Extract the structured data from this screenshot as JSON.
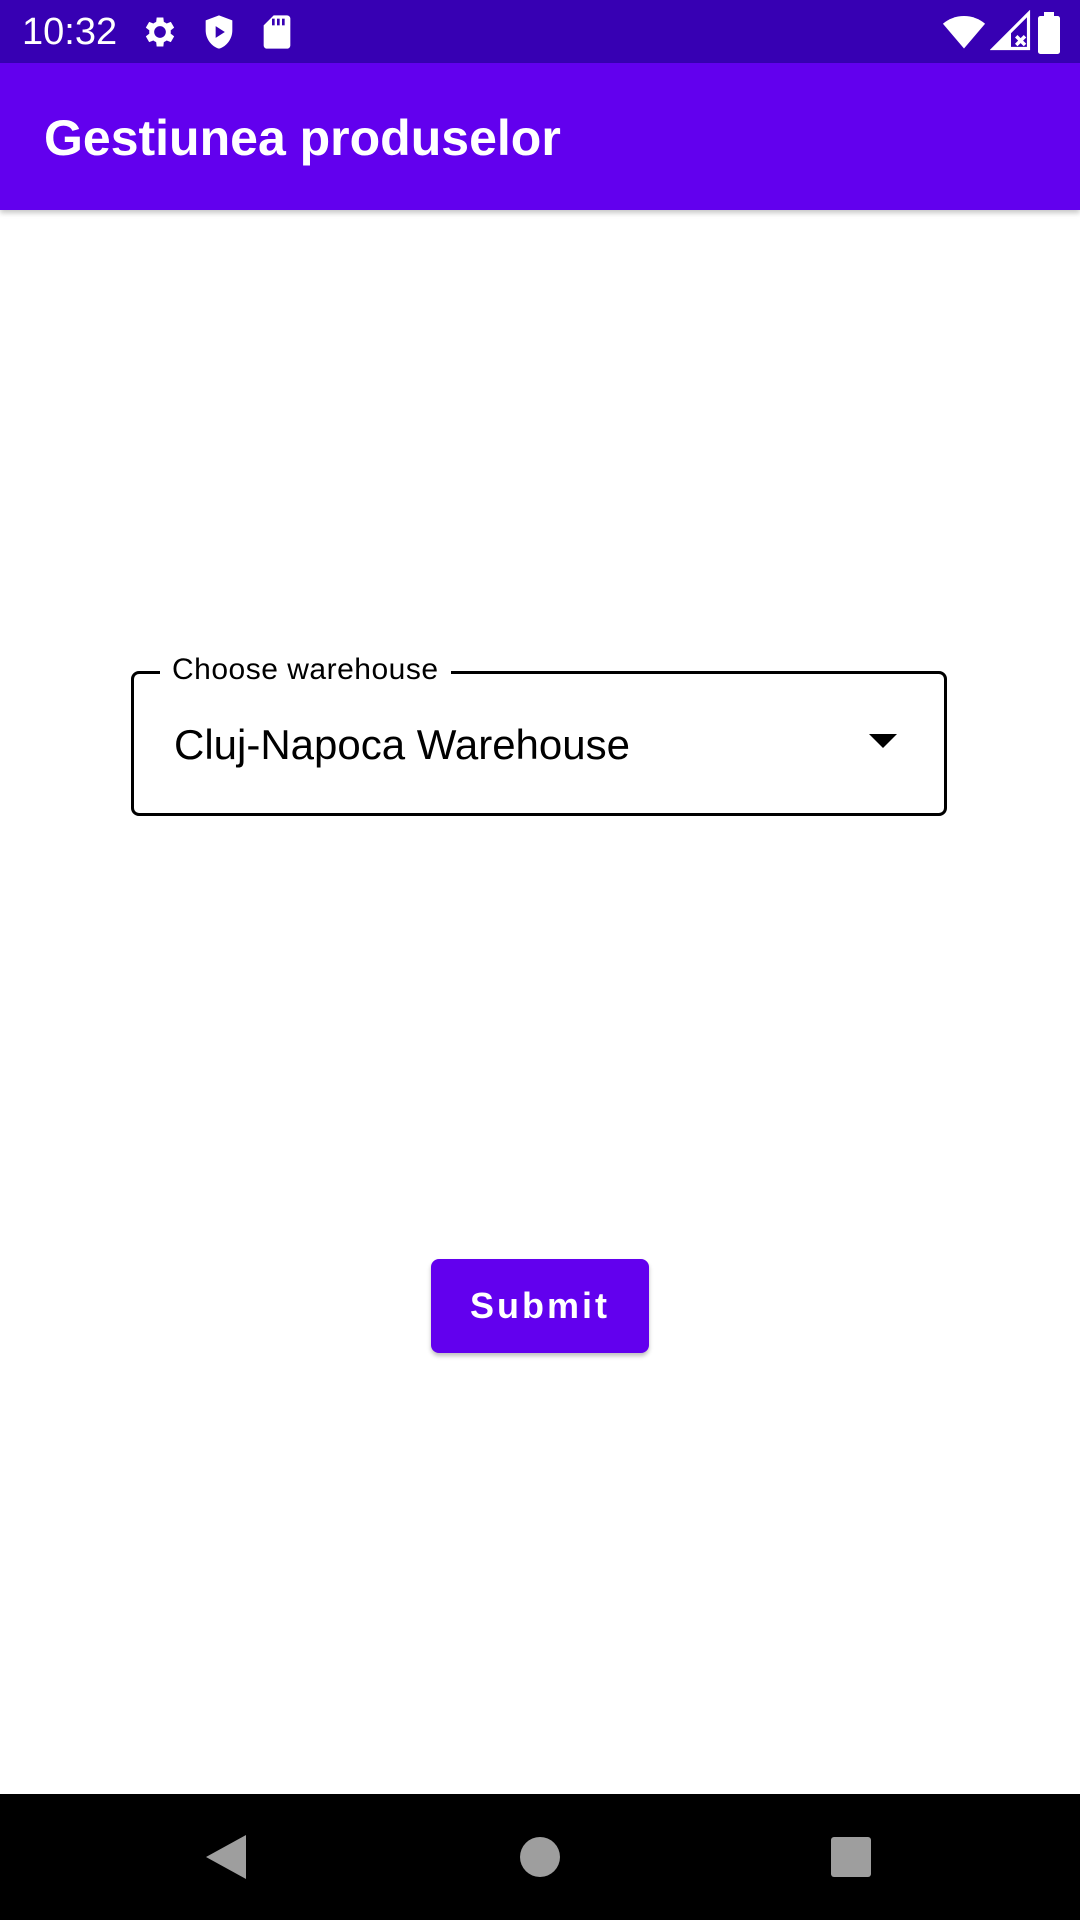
{
  "status_bar": {
    "time": "10:32",
    "left_icons": [
      "gear-icon",
      "shield-icon",
      "sd-card-icon"
    ],
    "right_icons": [
      "wifi-icon",
      "signal-icon",
      "battery-icon"
    ],
    "background": "#3700B3"
  },
  "app_bar": {
    "title": "Gestiunea produselor",
    "background": "#6200EE"
  },
  "warehouse_dropdown": {
    "label": "Choose warehouse",
    "selected_value": "Cluj-Napoca Warehouse",
    "icon": "caret-down-icon"
  },
  "submit_button": {
    "label": "Submit",
    "background": "#6200EE"
  },
  "nav_bar": {
    "buttons": [
      "back-icon",
      "home-icon",
      "recents-icon"
    ]
  }
}
